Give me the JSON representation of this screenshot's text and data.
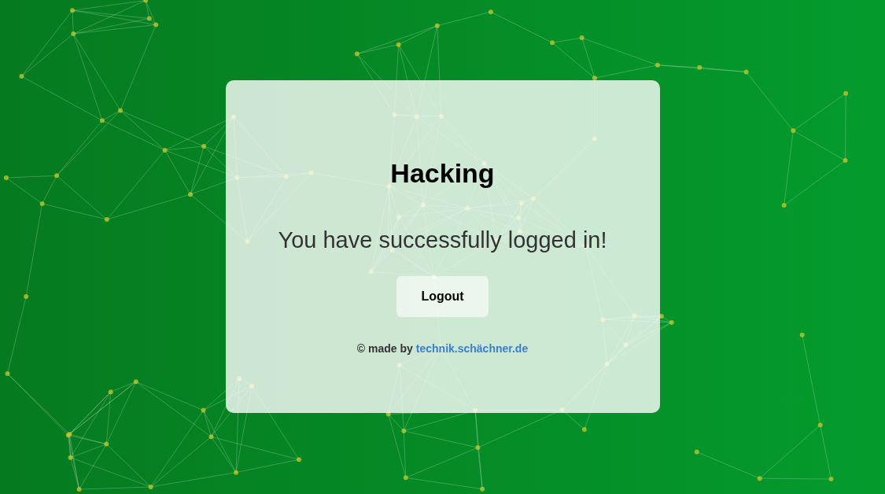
{
  "card": {
    "title": "Hacking",
    "message": "You have successfully logged in!",
    "button": "Logout",
    "footer": {
      "prefix": "© made by",
      "link": "technik.schächner.de"
    }
  }
}
